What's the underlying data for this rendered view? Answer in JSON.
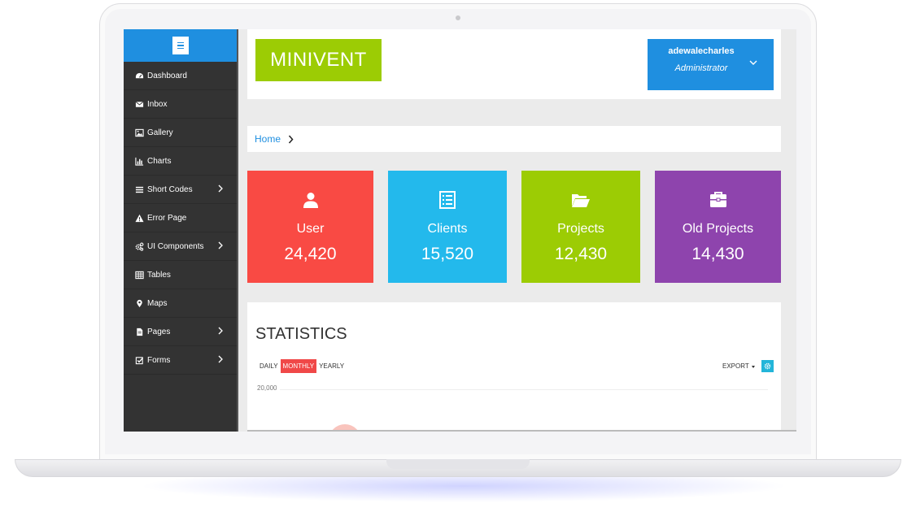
{
  "colors": {
    "brand_blue": "#1f8fe0",
    "brand_green": "#9ccc04",
    "sidebar_bg": "#333333",
    "card_red": "#f94a44",
    "card_cyan": "#23b9ec",
    "card_green": "#9ccc04",
    "card_purple": "#8e44ad",
    "tab_active": "#f04848",
    "settings_button": "#23b5d9"
  },
  "header": {
    "logo_text": "MINIVENT",
    "user": {
      "name": "adewalecharles",
      "role": "Administrator"
    }
  },
  "sidebar": {
    "items": [
      {
        "label": "Dashboard",
        "icon": "dashboard-icon"
      },
      {
        "label": "Inbox",
        "icon": "envelope-icon"
      },
      {
        "label": "Gallery",
        "icon": "picture-icon"
      },
      {
        "label": "Charts",
        "icon": "bar-chart-icon"
      },
      {
        "label": "Short Codes",
        "icon": "list-icon",
        "has_submenu": true
      },
      {
        "label": "Error Page",
        "icon": "warning-icon"
      },
      {
        "label": "UI Components",
        "icon": "cogs-icon",
        "has_submenu": true
      },
      {
        "label": "Tables",
        "icon": "table-icon"
      },
      {
        "label": "Maps",
        "icon": "map-marker-icon"
      },
      {
        "label": "Pages",
        "icon": "file-icon",
        "has_submenu": true
      },
      {
        "label": "Forms",
        "icon": "checkbox-icon",
        "has_submenu": true
      }
    ]
  },
  "breadcrumb": {
    "home": "Home"
  },
  "cards": [
    {
      "label": "User",
      "value": "24,420",
      "icon": "user-icon"
    },
    {
      "label": "Clients",
      "value": "15,520",
      "icon": "list-alt-icon"
    },
    {
      "label": "Projects",
      "value": "12,430",
      "icon": "folder-open-icon"
    },
    {
      "label": "Old Projects",
      "value": "14,430",
      "icon": "briefcase-icon"
    }
  ],
  "statistics": {
    "title": "STATISTICS",
    "tabs": [
      "DAILY",
      "MONTHLY",
      "YEARLY"
    ],
    "active_tab": "MONTHLY",
    "export_label": "EXPORT",
    "y_tick": "20,000"
  }
}
